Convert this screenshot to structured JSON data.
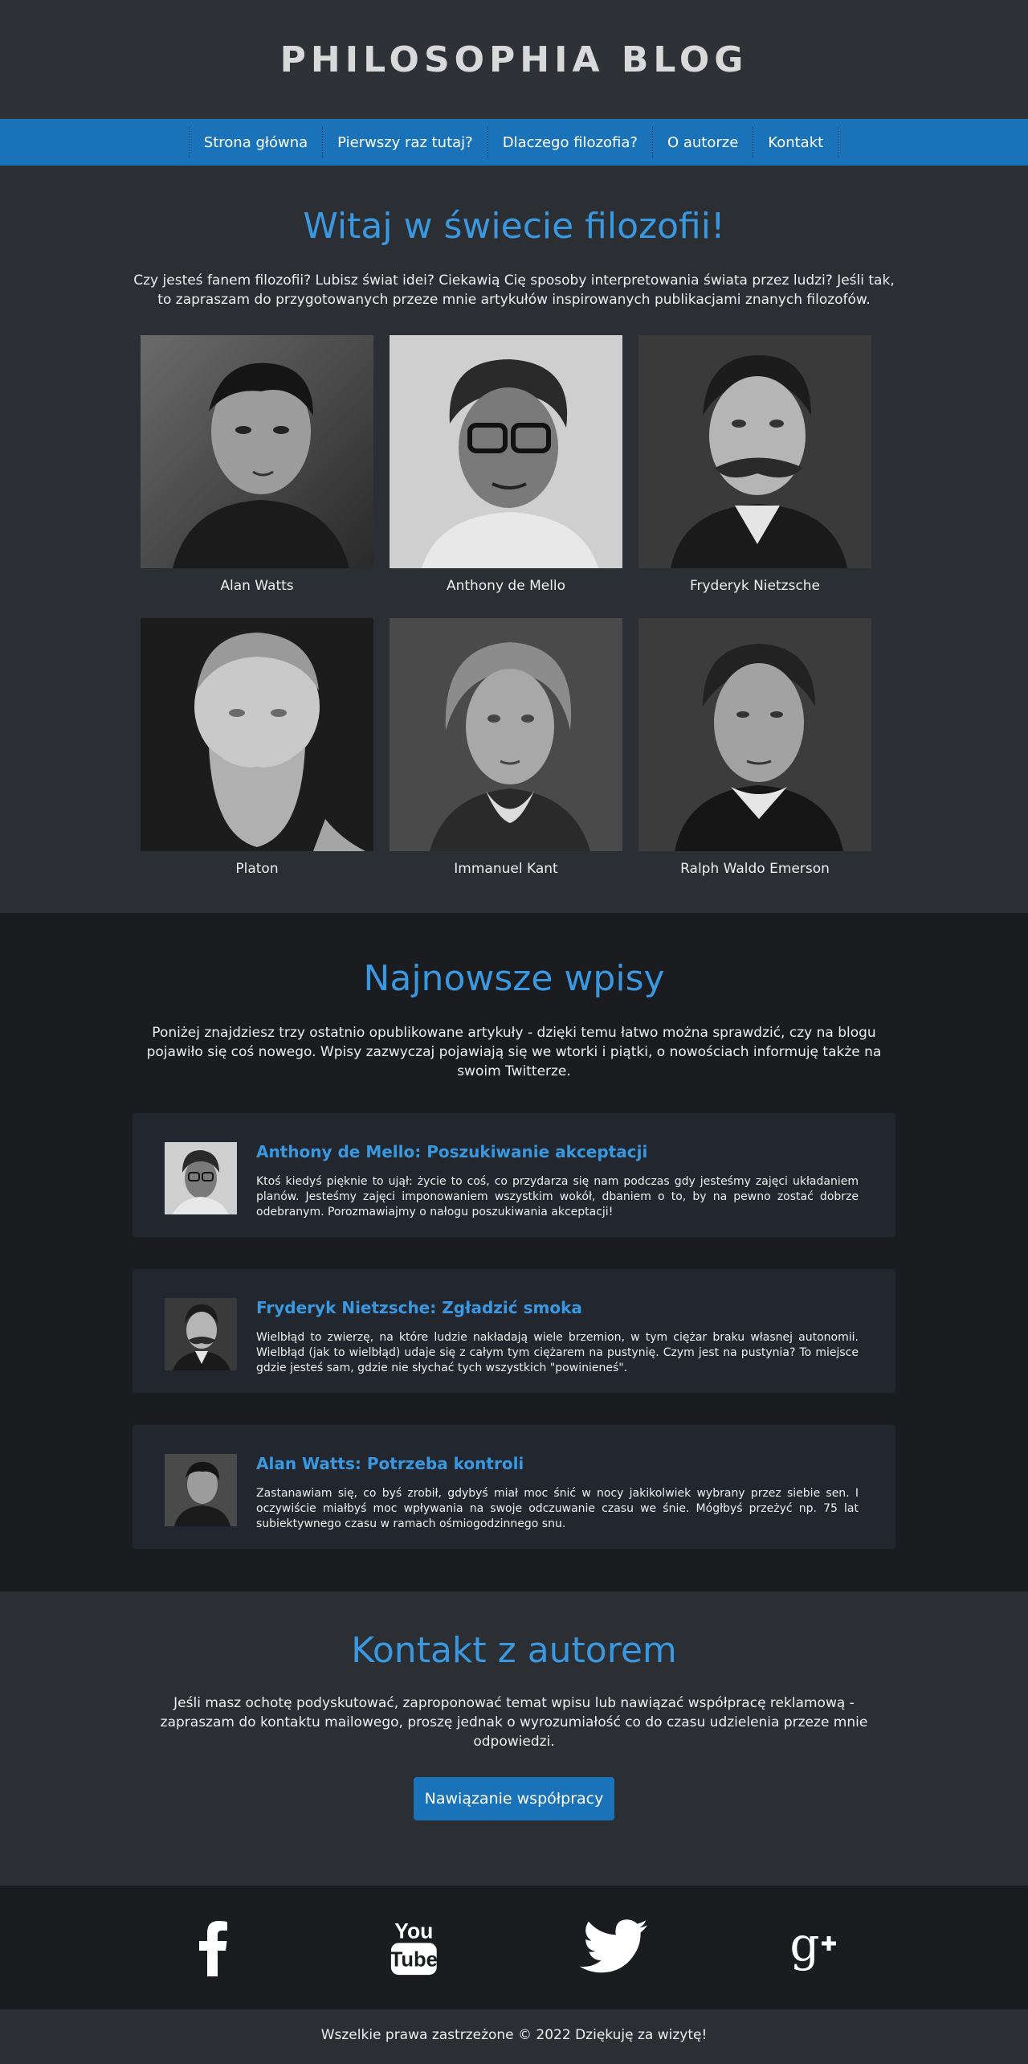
{
  "site": {
    "title": "PHILOSOPHIA BLOG"
  },
  "nav": {
    "items": [
      {
        "label": "Strona główna"
      },
      {
        "label": "Pierwszy raz tutaj?"
      },
      {
        "label": "Dlaczego filozofia?"
      },
      {
        "label": "O autorze"
      },
      {
        "label": "Kontakt"
      }
    ]
  },
  "welcome": {
    "heading": "Witaj w świecie filozofii!",
    "text": "Czy jesteś fanem filozofii? Lubisz świat idei? Ciekawią Cię sposoby interpretowania świata przez ludzi? Jeśli tak, to zapraszam do przygotowanych przeze mnie artykułów inspirowanych publikacjami znanych filozofów.",
    "philosophers": [
      {
        "name": "Alan Watts"
      },
      {
        "name": "Anthony de Mello"
      },
      {
        "name": "Fryderyk Nietzsche"
      },
      {
        "name": "Platon"
      },
      {
        "name": "Immanuel Kant"
      },
      {
        "name": "Ralph Waldo Emerson"
      }
    ]
  },
  "latest": {
    "heading": "Najnowsze wpisy",
    "text": "Poniżej znajdziesz trzy ostatnio opublikowane artykuły - dzięki temu łatwo można sprawdzić, czy na blogu pojawiło się coś nowego. Wpisy zazwyczaj pojawiają się we wtorki i piątki, o nowościach informuję także na swoim Twitterze.",
    "posts": [
      {
        "title": "Anthony de Mello: Poszukiwanie akceptacji",
        "text": "Ktoś kiedyś pięknie to ujął: życie to coś, co przydarza się nam podczas gdy jesteśmy zajęci układaniem planów. Jesteśmy zajęci imponowaniem wszystkim wokół, dbaniem o to, by na pewno zostać dobrze odebranym. Porozmawiajmy o nałogu poszukiwania akceptacji!"
      },
      {
        "title": "Fryderyk Nietzsche: Zgładzić smoka",
        "text": "Wielbłąd to zwierzę, na które ludzie nakładają wiele brzemion, w tym ciężar braku własnej autonomii. Wielbłąd (jak to wielbłąd) udaje się z całym tym ciężarem na pustynię. Czym jest na pustynia? To miejsce gdzie jesteś sam, gdzie nie słychać tych wszystkich \"powinieneś\"."
      },
      {
        "title": "Alan Watts: Potrzeba kontroli",
        "text": "Zastanawiam się, co byś zrobił, gdybyś miał moc śnić w nocy jakikolwiek wybrany przez siebie sen. I oczywiście miałbyś moc wpływania na swoje odczuwanie czasu we śnie. Mógłbyś przeżyć np. 75 lat subiektywnego czasu w ramach ośmiogodzinnego snu."
      }
    ]
  },
  "contact": {
    "heading": "Kontakt z autorem",
    "text": "Jeśli masz ochotę podyskutować, zaproponować temat wpisu lub nawiązać współpracę reklamową - zapraszam do kontaktu mailowego, proszę jednak o wyrozumiałość co do czasu udzielenia przeze mnie odpowiedzi.",
    "button_label": "Nawiązanie współpracy"
  },
  "social": {
    "youtube_top": "You",
    "youtube_bottom": "Tube"
  },
  "footer": {
    "text": "Wszelkie prawa zastrzeżone © 2022 Dziękuję za wizytę!"
  },
  "colors": {
    "accent": "#3a98e0",
    "nav": "#1a73b9",
    "dark": "#1a1c20",
    "panel": "#2b2e33"
  }
}
